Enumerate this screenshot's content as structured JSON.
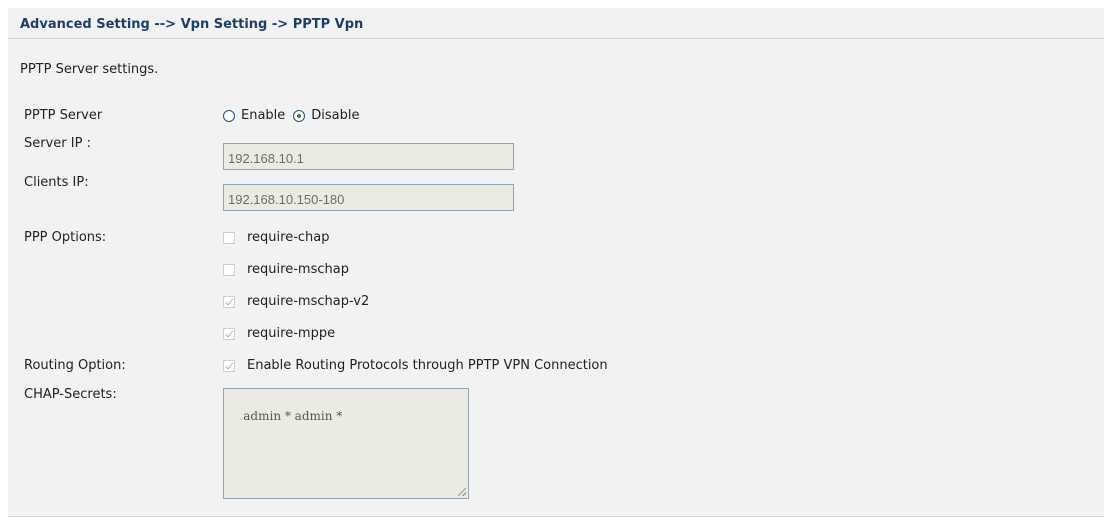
{
  "breadcrumb": "Advanced Setting --> Vpn Setting -> PPTP Vpn",
  "intro": "PPTP Server settings.",
  "pptp_server": {
    "label": "PPTP Server",
    "options": [
      {
        "label": "Enable",
        "checked": false
      },
      {
        "label": "Disable",
        "checked": true
      }
    ]
  },
  "server_ip": {
    "label": "Server IP :",
    "value": "192.168.10.1"
  },
  "clients_ip": {
    "label": "Clients IP:",
    "value": "192.168.10.150-180"
  },
  "ppp_options": {
    "label": "PPP Options:",
    "items": [
      {
        "label": "require-chap",
        "checked": false
      },
      {
        "label": "require-mschap",
        "checked": false
      },
      {
        "label": "require-mschap-v2",
        "checked": true
      },
      {
        "label": "require-mppe",
        "checked": true
      }
    ]
  },
  "routing_option": {
    "label": "Routing Option:",
    "checkbox_label": "Enable Routing Protocols through PPTP VPN Connection",
    "checked": true
  },
  "chap_secrets": {
    "label": "CHAP-Secrets:",
    "value": "admin * admin *"
  }
}
